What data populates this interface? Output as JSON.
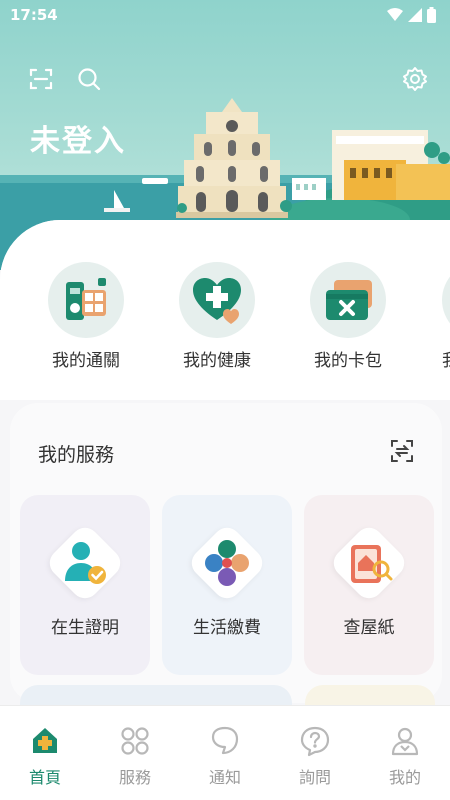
{
  "status_bar": {
    "time": "17:54"
  },
  "header": {
    "user_title": "未登入"
  },
  "quick_actions": [
    {
      "label": "我的通關",
      "icon": "customs-calculator-icon"
    },
    {
      "label": "我的健康",
      "icon": "health-heart-icon"
    },
    {
      "label": "我的卡包",
      "icon": "card-wallet-icon"
    },
    {
      "label": "我",
      "icon": "more-icon"
    }
  ],
  "services": {
    "title": "我的服務",
    "items": [
      {
        "label": "在生證明",
        "icon": "life-certificate-icon"
      },
      {
        "label": "生活繳費",
        "icon": "bill-payment-icon"
      },
      {
        "label": "查屋紙",
        "icon": "property-search-icon"
      }
    ]
  },
  "bottom_nav": [
    {
      "label": "首頁",
      "icon": "home-icon",
      "active": true
    },
    {
      "label": "服務",
      "icon": "services-grid-icon",
      "active": false
    },
    {
      "label": "通知",
      "icon": "notification-icon",
      "active": false
    },
    {
      "label": "詢問",
      "icon": "question-icon",
      "active": false
    },
    {
      "label": "我的",
      "icon": "profile-icon",
      "active": false
    }
  ],
  "colors": {
    "accent": "#1d8a6e",
    "banner": "#8fd3cc",
    "sea": "#3b9fa6"
  }
}
